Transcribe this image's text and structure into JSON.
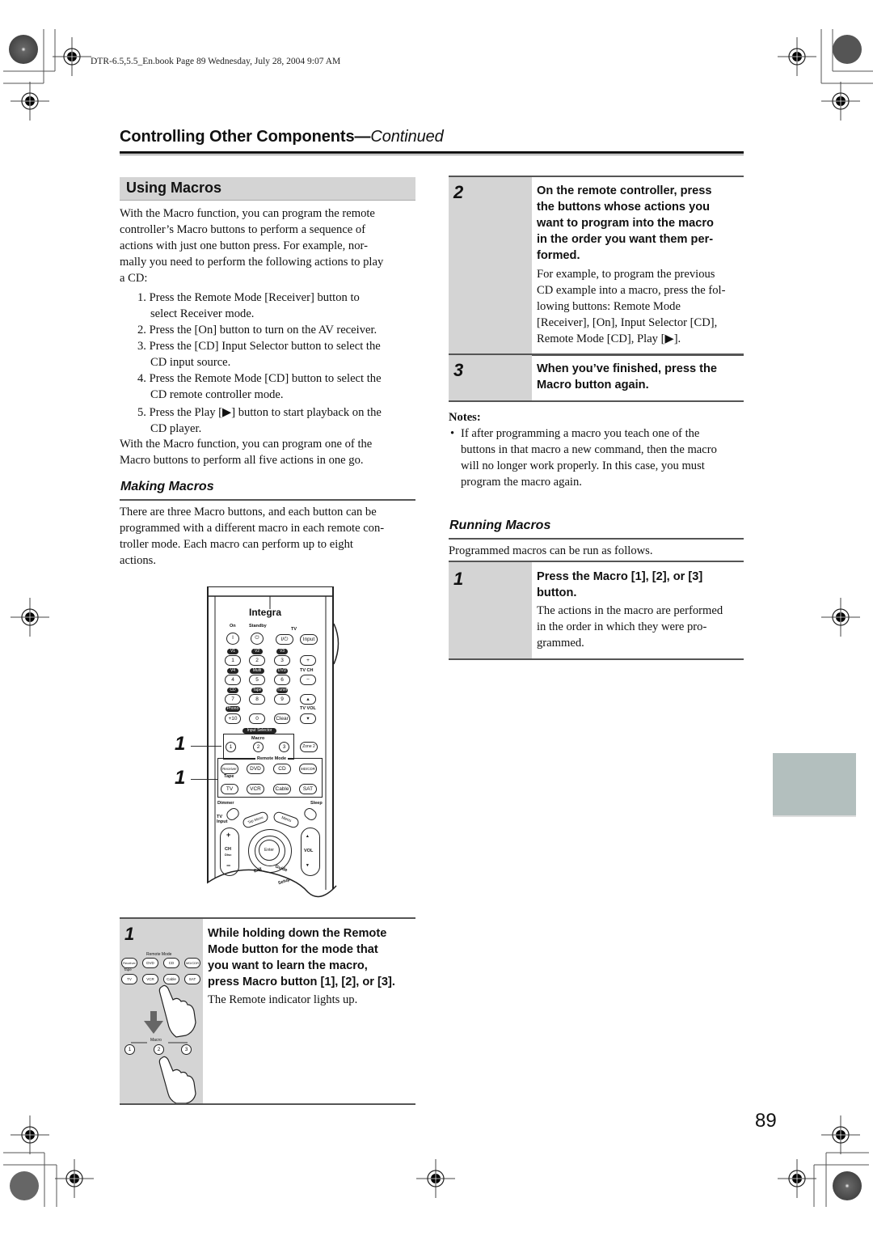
{
  "print_header": "DTR-6.5,5.5_En.book  Page 89  Wednesday, July 28, 2004  9:07 AM",
  "page_title": {
    "main": "Controlling Other Components",
    "dash": "—",
    "continued": "Continued"
  },
  "using_macros": {
    "heading": "Using Macros",
    "intro_lines": [
      "With the Macro function, you can program the remote",
      "controller’s Macro buttons to perform a sequence of",
      "actions with just one button press. For example, nor-",
      "mally you need to perform the following actions to play",
      "a CD:"
    ],
    "steps": [
      {
        "num": "1.",
        "lines": [
          "Press the Remote Mode [Receiver] button to",
          "select Receiver mode."
        ]
      },
      {
        "num": "2.",
        "lines": [
          "Press the [On] button to turn on the AV receiver."
        ]
      },
      {
        "num": "3.",
        "lines": [
          "Press the [CD] Input Selector button to select the",
          "CD input source."
        ]
      },
      {
        "num": "4.",
        "lines": [
          "Press the Remote Mode [CD] button to select the",
          "CD remote controller mode."
        ]
      },
      {
        "num": "5.",
        "lines": [
          "Press the Play [▶] button to start playback on the",
          "CD player."
        ]
      }
    ],
    "outro_lines": [
      "With the Macro function, you can program one of the",
      "Macro buttons to perform all five actions in one go."
    ]
  },
  "making_macros": {
    "heading": "Making Macros",
    "lines": [
      "There are three Macro buttons, and each button can be",
      "programmed with a different macro in each remote con-",
      "troller mode. Each macro can perform up to eight",
      "actions."
    ],
    "callouts": [
      "1",
      "1"
    ],
    "step1": {
      "num": "1",
      "head_lines": [
        "While holding down the Remote",
        "Mode button for the mode that",
        "you want to learn the macro,",
        "press Macro button [1], [2], or [3]."
      ],
      "text": "The Remote indicator lights up.",
      "illus": {
        "remote_mode_label": "Remote Mode",
        "row1": [
          "Receiver",
          "DVD",
          "CD",
          "MD/CDR"
        ],
        "tape_label": "Tape",
        "row2": [
          "TV",
          "VCR",
          "Cable",
          "SAT"
        ],
        "macro_label": "Macro",
        "macro_buttons": [
          "1",
          "2",
          "3"
        ]
      }
    },
    "step2": {
      "num": "2",
      "head_lines": [
        "On the remote controller, press",
        "the buttons whose actions you",
        "want to program into the macro",
        "in the order you want them per-",
        "formed."
      ],
      "text_lines": [
        "For example, to program the previous",
        "CD example into a macro, press the fol-",
        "lowing buttons: Remote Mode",
        "[Receiver], [On], Input Selector [CD],",
        "Remote Mode [CD], Play [▶]."
      ]
    },
    "step3": {
      "num": "3",
      "head_lines": [
        "When you’ve finished, press the",
        "Macro button again."
      ]
    },
    "notes": {
      "heading": "Notes:",
      "items": [
        {
          "bullet": "•",
          "lines": [
            "If after programming a macro you teach one of the",
            "buttons in that macro a new command, then the macro",
            "will no longer work properly. In this case, you must",
            "program the macro again."
          ]
        }
      ]
    }
  },
  "running_macros": {
    "heading": "Running Macros",
    "intro": "Programmed macros can be run as follows.",
    "step1": {
      "num": "1",
      "head_lines": [
        "Press the Macro [1], [2], or [3]",
        "button."
      ],
      "text_lines": [
        "The actions in the macro are performed",
        "in the order in which they were pro-",
        "grammed."
      ]
    }
  },
  "remote": {
    "brand": "Integra",
    "on": "On",
    "standby": "Standby",
    "tv": "TV",
    "power_glyph": "I",
    "standby_glyph": "⏻",
    "tv_power": "I/⏻",
    "tv_input": "Input",
    "num_tags": [
      "V1",
      "V2",
      "V3",
      "V4",
      "Multi CH",
      "DVD",
      "CD",
      "Tape",
      "Tuner",
      "Phono"
    ],
    "num_keys": [
      "1",
      "2",
      "3",
      "4",
      "5",
      "6",
      "7",
      "8",
      "9",
      "+10",
      "0",
      "Clear"
    ],
    "tv_ch": "TV CH",
    "tv_vol": "TV VOL",
    "plus": "+",
    "minus": "−",
    "up": "▴",
    "down": "▾",
    "input_selector": "Input Selector",
    "macro": "Macro",
    "macro_keys": [
      "1",
      "2",
      "3"
    ],
    "zone2": "Zone 2",
    "remote_mode": "Remote Mode",
    "mode_row1": [
      "Receiver",
      "DVD",
      "CD",
      "MD/CDR"
    ],
    "tape": "Tape",
    "mode_row2": [
      "TV",
      "VCR",
      "Cable",
      "SAT"
    ],
    "dimmer": "Dimmer",
    "sleep": "Sleep",
    "tv_input_label": "TV Input",
    "top_menu": "Top Menu",
    "menu": "Menu",
    "ch": "CH",
    "disc": "Disc",
    "enter": "Enter",
    "vol": "VOL",
    "exit": "Exit",
    "guide": "Guide",
    "setup": "Setup"
  },
  "page_number": "89"
}
